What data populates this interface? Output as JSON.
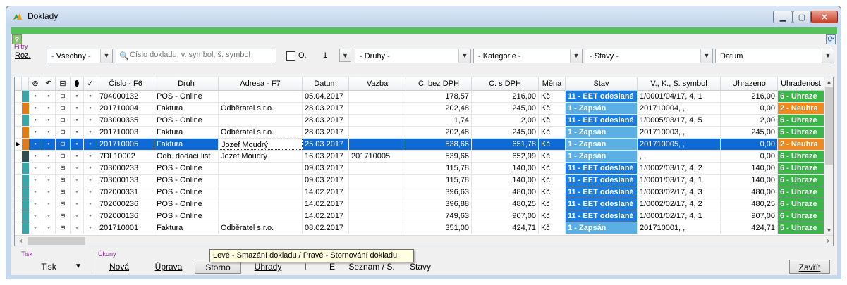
{
  "window": {
    "title": "Doklady"
  },
  "help_label": "?",
  "filters": {
    "group_label": "Filtry",
    "roz_label": "Roz.",
    "roz_value": "- Všechny -",
    "search_placeholder": "Číslo dokladu, v. symbol, š. symbol",
    "checkbox_label": "O.",
    "number_value": "1",
    "druhy_value": "- Druhy -",
    "kategorie_value": "- Kategorie -",
    "stavy_value": "- Stavy -",
    "datum_value": "Datum"
  },
  "grid": {
    "columns": [
      "Číslo - F6",
      "Druh",
      "Adresa - F7",
      "Datum",
      "Vazba",
      "C. bez DPH",
      "C. s DPH",
      "Měna",
      "Stav",
      "V., K., S. symbol",
      "Uhrazeno",
      "Uhradenost"
    ],
    "icon_columns": [
      "attachment-icon",
      "undo-icon",
      "cash-register-icon",
      "pin-icon",
      "checkmark-icon"
    ],
    "rows": [
      {
        "cislo": "704000132",
        "druh": "POS - Online",
        "adresa": "",
        "datum": "05.04.2017",
        "vazba": "",
        "bez": "178,57",
        "s": "216,00",
        "mena": "Kč",
        "stav": "11 - EET odeslané",
        "stav_type": "eet",
        "symbol": "1/0001/04/17, 4, 1",
        "uhrazeno": "216,00",
        "uhradenost": "6 - Uhraze",
        "uhr_type": "green",
        "ind_color": "#3aa6a8"
      },
      {
        "cislo": "201710004",
        "druh": "Faktura",
        "adresa": "Odběratel s.r.o.",
        "datum": "28.03.2017",
        "vazba": "",
        "bez": "202,48",
        "s": "245,00",
        "mena": "Kč",
        "stav": "1 - Zapsán",
        "stav_type": "zap",
        "symbol": "201710004, ,",
        "uhrazeno": "0,00",
        "uhradenost": "2 - Neuhra",
        "uhr_type": "orange",
        "ind_color": "#e07b1a"
      },
      {
        "cislo": "703000335",
        "druh": "POS - Online",
        "adresa": "",
        "datum": "28.03.2017",
        "vazba": "",
        "bez": "1,74",
        "s": "2,00",
        "mena": "Kč",
        "stav": "11 - EET odeslané",
        "stav_type": "eet",
        "symbol": "1/0005/03/17, 4, 5",
        "uhrazeno": "2,00",
        "uhradenost": "6 - Uhraze",
        "uhr_type": "green",
        "ind_color": "#3aa6a8"
      },
      {
        "cislo": "201710003",
        "druh": "Faktura",
        "adresa": "Odběratel s.r.o.",
        "datum": "28.03.2017",
        "vazba": "",
        "bez": "202,48",
        "s": "245,00",
        "mena": "Kč",
        "stav": "1 - Zapsán",
        "stav_type": "zap",
        "symbol": "201710003, ,",
        "uhrazeno": "245,00",
        "uhradenost": "5 - Uhraze",
        "uhr_type": "green",
        "ind_color": "#e07b1a"
      },
      {
        "cislo": "201710005",
        "druh": "Faktura",
        "adresa": "Jozef Moudrý",
        "datum": "25.03.2017",
        "vazba": "",
        "bez": "538,66",
        "s": "651,78",
        "mena": "Kč",
        "stav": "1 - Zapsán",
        "stav_type": "zap",
        "symbol": "201710005, ,",
        "uhrazeno": "0,00",
        "uhradenost": "2 - Neuhra",
        "uhr_type": "orange",
        "ind_color": "#e07b1a",
        "selected": true
      },
      {
        "cislo": "7DL10002",
        "druh": "Odb. dodací list",
        "adresa": "Jozef Moudrý",
        "datum": "16.03.2017",
        "vazba": "201710005",
        "bez": "539,66",
        "s": "652,99",
        "mena": "Kč",
        "stav": "1 - Zapsán",
        "stav_type": "zap",
        "symbol": ", ,",
        "uhrazeno": "0,00",
        "uhradenost": "6 - Uhraze",
        "uhr_type": "green",
        "ind_color": "#2f4f4f"
      },
      {
        "cislo": "703000233",
        "druh": "POS - Online",
        "adresa": "",
        "datum": "09.03.2017",
        "vazba": "",
        "bez": "115,78",
        "s": "140,00",
        "mena": "Kč",
        "stav": "11 - EET odeslané",
        "stav_type": "eet",
        "symbol": "1/0002/03/17, 4, 2",
        "uhrazeno": "140,00",
        "uhradenost": "6 - Uhraze",
        "uhr_type": "green",
        "ind_color": "#3aa6a8"
      },
      {
        "cislo": "703000133",
        "druh": "POS - Online",
        "adresa": "",
        "datum": "09.03.2017",
        "vazba": "",
        "bez": "115,78",
        "s": "140,00",
        "mena": "Kč",
        "stav": "11 - EET odeslané",
        "stav_type": "eet",
        "symbol": "1/0001/03/17, 4, 1",
        "uhrazeno": "140,00",
        "uhradenost": "6 - Uhraze",
        "uhr_type": "green",
        "ind_color": "#3aa6a8"
      },
      {
        "cislo": "702000331",
        "druh": "POS - Online",
        "adresa": "",
        "datum": "14.02.2017",
        "vazba": "",
        "bez": "396,63",
        "s": "480,00",
        "mena": "Kč",
        "stav": "11 - EET odeslané",
        "stav_type": "eet",
        "symbol": "1/0003/02/17, 4, 3",
        "uhrazeno": "480,00",
        "uhradenost": "6 - Uhraze",
        "uhr_type": "green",
        "ind_color": "#3aa6a8"
      },
      {
        "cislo": "702000236",
        "druh": "POS - Online",
        "adresa": "",
        "datum": "14.02.2017",
        "vazba": "",
        "bez": "396,88",
        "s": "480,25",
        "mena": "Kč",
        "stav": "11 - EET odeslané",
        "stav_type": "eet",
        "symbol": "1/0002/02/17, 4, 2",
        "uhrazeno": "480,25",
        "uhradenost": "6 - Uhraze",
        "uhr_type": "green",
        "ind_color": "#3aa6a8"
      },
      {
        "cislo": "702000136",
        "druh": "POS - Online",
        "adresa": "",
        "datum": "14.02.2017",
        "vazba": "",
        "bez": "749,63",
        "s": "907,00",
        "mena": "Kč",
        "stav": "11 - EET odeslané",
        "stav_type": "eet",
        "symbol": "1/0001/02/17, 4, 1",
        "uhrazeno": "907,00",
        "uhradenost": "6 - Uhraze",
        "uhr_type": "green",
        "ind_color": "#3aa6a8"
      },
      {
        "cislo": "201710001",
        "druh": "Faktura",
        "adresa": "Odběratel s.r.o.",
        "datum": "08.02.2017",
        "vazba": "",
        "bez": "351,00",
        "s": "424,71",
        "mena": "Kč",
        "stav": "1 - Zapsán",
        "stav_type": "zap",
        "symbol": "201710001, ,",
        "uhrazeno": "424,71",
        "uhradenost": "5 - Uhraze",
        "uhr_type": "green",
        "ind_color": "#3aa6a8"
      }
    ]
  },
  "bottom": {
    "tisk_group": "Tisk",
    "tisk_button": "Tisk",
    "ukony_group": "Úkony",
    "nova": "Nová",
    "uprava": "Úprava",
    "storno": "Storno",
    "uhrady": "Uhrady",
    "i": "I",
    "e": "E",
    "seznam": "Seznam / S.",
    "stavy": "Stavy",
    "zavrit": "Zavřít"
  },
  "tooltip": "Levé - Smazání dokladu / Pravé - Stornování dokladu"
}
